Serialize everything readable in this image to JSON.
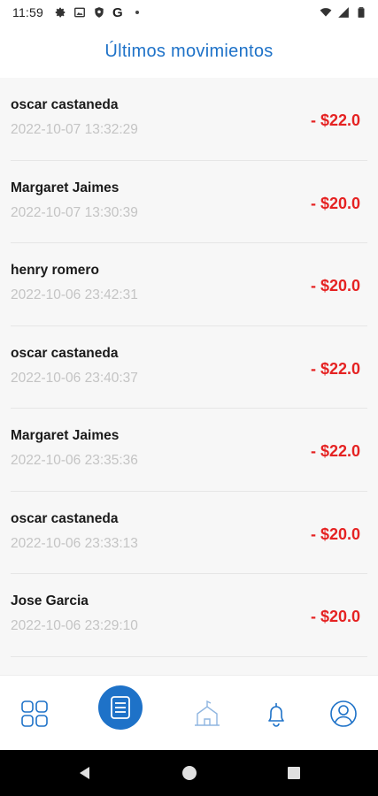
{
  "status_bar": {
    "time": "11:59",
    "left_icons": [
      "settings-icon",
      "image-icon",
      "shield-icon"
    ],
    "g_label": "G",
    "right_icons": [
      "wifi-icon",
      "cell-signal-icon",
      "battery-icon"
    ]
  },
  "header": {
    "title": "Últimos movimientos"
  },
  "transactions": [
    {
      "name": "oscar castaneda",
      "date": "2022-10-07 13:32:29",
      "amount": "- $22.0"
    },
    {
      "name": "Margaret Jaimes",
      "date": "2022-10-07 13:30:39",
      "amount": "- $20.0"
    },
    {
      "name": "henry romero",
      "date": "2022-10-06 23:42:31",
      "amount": "- $20.0"
    },
    {
      "name": "oscar castaneda",
      "date": "2022-10-06 23:40:37",
      "amount": "- $22.0"
    },
    {
      "name": "Margaret Jaimes",
      "date": "2022-10-06 23:35:36",
      "amount": "- $22.0"
    },
    {
      "name": "oscar castaneda",
      "date": "2022-10-06 23:33:13",
      "amount": "- $20.0"
    },
    {
      "name": "Jose  Garcia",
      "date": "2022-10-06 23:29:10",
      "amount": "- $20.0"
    }
  ],
  "bottom_nav": {
    "items": [
      "grid-icon",
      "list-icon",
      "home-icon",
      "bell-icon",
      "profile-icon"
    ],
    "active": "list-icon"
  },
  "colors": {
    "accent": "#1e72c8",
    "amount": "#e52222",
    "date": "#c4c4c4",
    "list_bg": "#f7f7f7"
  }
}
